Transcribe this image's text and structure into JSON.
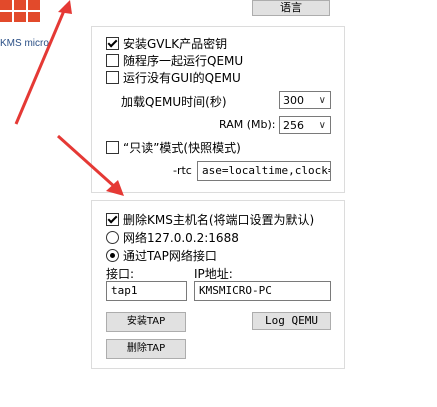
{
  "logo": {
    "text": "KMS micro"
  },
  "header": {
    "language_button": "语言"
  },
  "qemu_group": {
    "install_gvlk": {
      "label": "安装GVLK产品密钥",
      "checked": true
    },
    "run_with_program": {
      "label": "随程序一起运行QEMU",
      "checked": false
    },
    "run_without_gui": {
      "label": "运行没有GUI的QEMU",
      "checked": false
    },
    "load_time_label": "加载QEMU时间(秒)",
    "load_time_value": "300",
    "ram_label": "RAM (Mb):",
    "ram_value": "256",
    "readonly": {
      "label": "“只读”模式(快照模式)",
      "checked": false
    },
    "rtc_label": "-rtc",
    "rtc_value": "ase=localtime,clock=h"
  },
  "network_group": {
    "delete_kms_hostname": {
      "label": "删除KMS主机名(将端口设置为默认)",
      "checked": true
    },
    "radio_network": {
      "label": "网络127.0.0.2:1688",
      "selected": false
    },
    "radio_tap": {
      "label": "通过TAP网络接口",
      "selected": true
    },
    "interface_label": "接口:",
    "interface_value": "tap1",
    "ip_label": "IP地址:",
    "ip_value": "KMSMICRO-PC",
    "install_tap": "安装TAP",
    "log_qemu": "Log QEMU",
    "remove_tap": "删除TAP"
  },
  "colors": {
    "arrow": "#e53935"
  }
}
